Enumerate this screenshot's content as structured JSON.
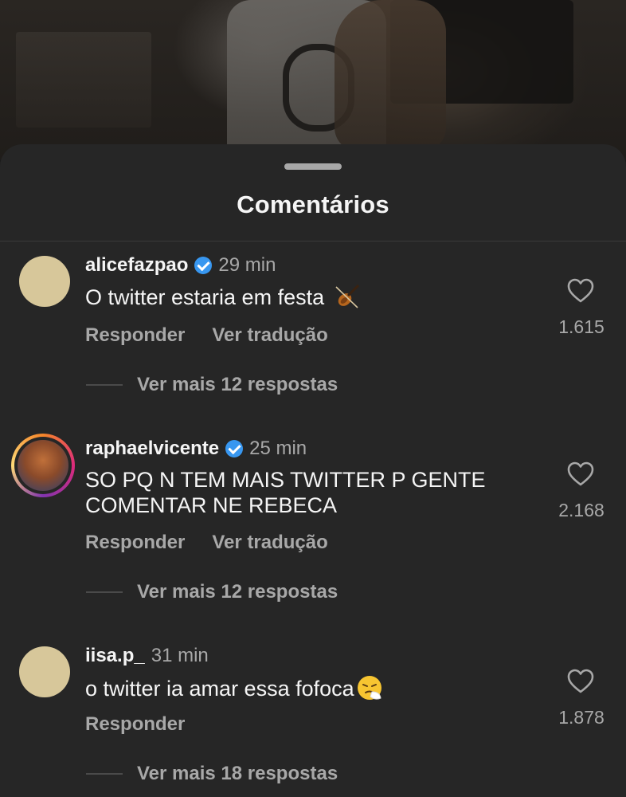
{
  "sheet": {
    "title": "Comentários"
  },
  "comments": [
    {
      "username": "alicefazpao",
      "verified": true,
      "time": "29 min",
      "text": "O twitter estaria em festa",
      "emoji": "violin-emoji",
      "reply_label": "Responder",
      "translate_label": "Ver tradução",
      "likes": "1.615",
      "view_replies": "Ver mais 12 respostas"
    },
    {
      "username": "raphaelvicente",
      "verified": true,
      "time": "25 min",
      "text_line1": "SO PQ N TEM MAIS TWITTER P GENTE",
      "text_line2": "COMENTAR NE REBECA",
      "reply_label": "Responder",
      "translate_label": "Ver tradução",
      "likes": "2.168",
      "view_replies": "Ver mais 12 respostas"
    },
    {
      "username": "iisa.p_",
      "verified": false,
      "time": "31 min",
      "text": "o twitter ia amar essa fofoca",
      "emoji": "sneezing-face-emoji",
      "reply_label": "Responder",
      "likes": "1.878",
      "view_replies": "Ver mais 18 respostas"
    }
  ],
  "colors": {
    "sheet_bg": "#262626",
    "verified_blue": "#3897f0",
    "secondary_text": "#a8a8a8"
  }
}
